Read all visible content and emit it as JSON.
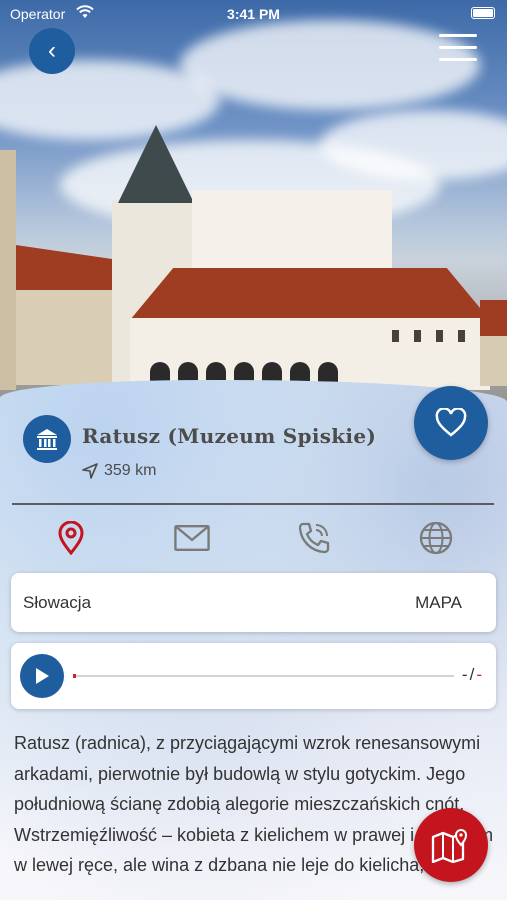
{
  "status_bar": {
    "carrier": "Operator",
    "time": "3:41 PM"
  },
  "header": {
    "back_label": "‹"
  },
  "place": {
    "title": "Ratusz (Muzeum Spiskie)",
    "distance": "359 km"
  },
  "location": {
    "country": "Słowacja",
    "map_label": "MAPA"
  },
  "audio": {
    "time_text_a": "-",
    "time_text_b": "/",
    "time_text_c": "-"
  },
  "description": "Ratusz (radnica), z przyciągającymi wzrok renesansowymi arkadami, pierwotnie był budowlą w stylu gotyckim. Jego południową ścianę zdobią alegorie mieszczańskich cnót. Wstrzemięźliwość – kobieta z kielichem w prawej i dzbanem w lewej ręce, ale wina z dzbana nie leje do kielicha, ale za",
  "colors": {
    "primary_blue": "#1e5d9e",
    "accent_red": "#c4141e",
    "text": "#333333"
  }
}
